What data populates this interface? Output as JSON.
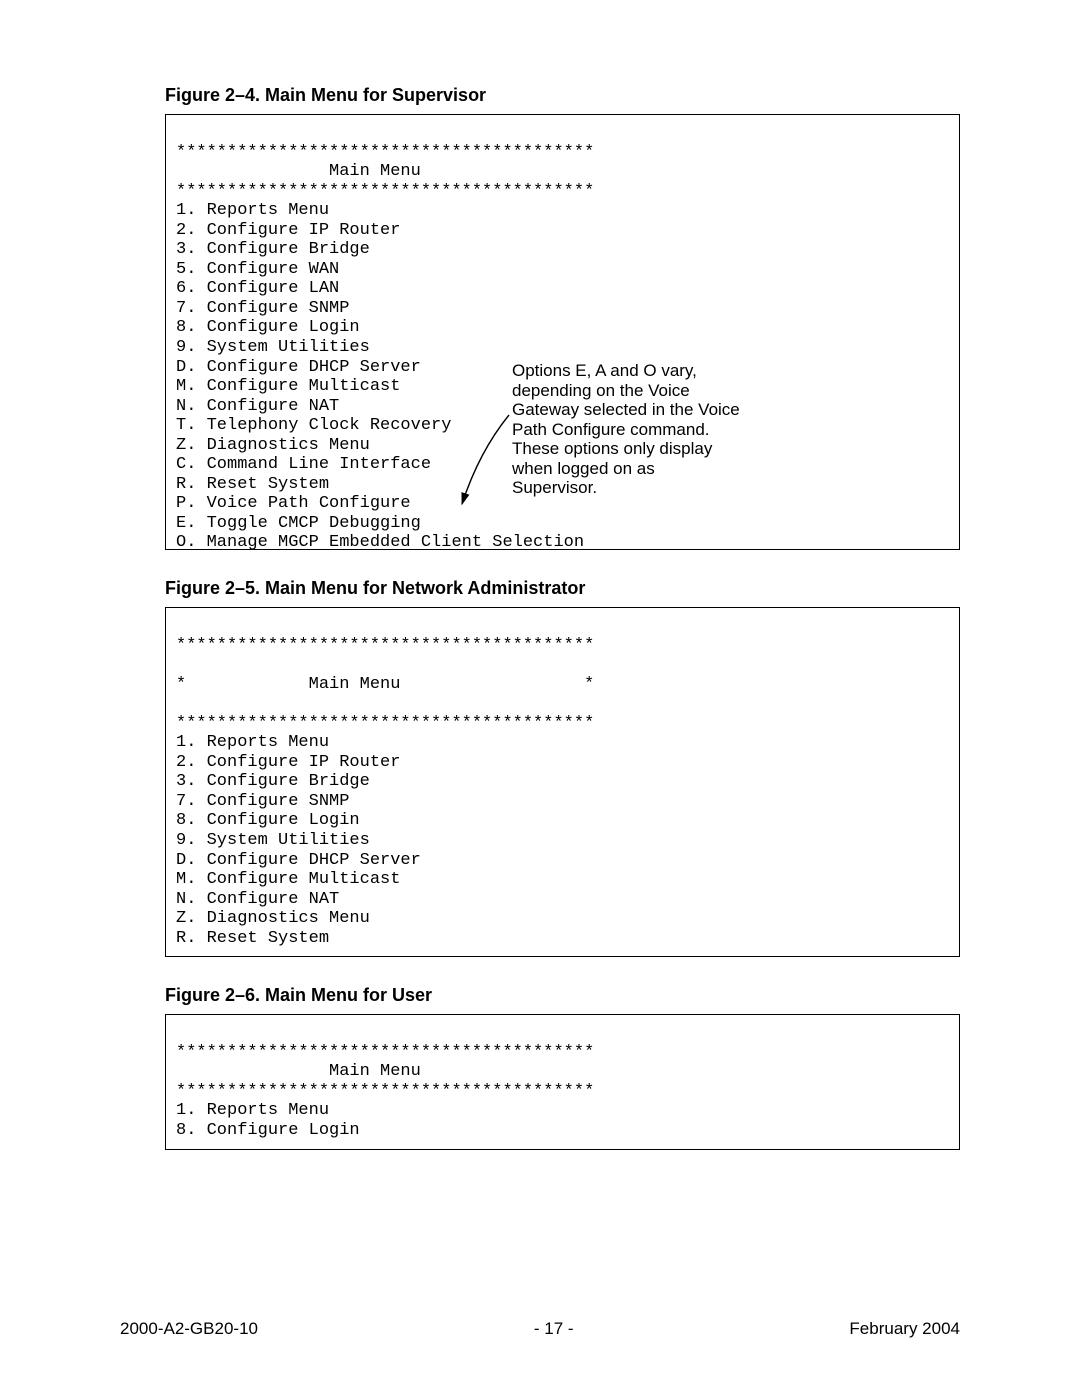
{
  "figures": {
    "fig24": {
      "caption": "Figure 2–4.  Main Menu for Supervisor",
      "star_line": "*****************************************",
      "title_line": "               Main Menu",
      "items": [
        "1. Reports Menu",
        "2. Configure IP Router",
        "3. Configure Bridge",
        "5. Configure WAN",
        "6. Configure LAN",
        "7. Configure SNMP",
        "8. Configure Login",
        "9. System Utilities",
        "D. Configure DHCP Server",
        "M. Configure Multicast",
        "N. Configure NAT",
        "T. Telephony Clock Recovery",
        "Z. Diagnostics Menu",
        "C. Command Line Interface",
        "R. Reset System",
        "P. Voice Path Configure",
        "E. Toggle CMCP Debugging",
        "O. Manage MGCP Embedded Client Selection"
      ],
      "annotation": "Options E, A and O vary, depending on the Voice Gateway selected in the Voice Path Configure command. These options only display when logged on as Supervisor."
    },
    "fig25": {
      "caption": "Figure 2–5.  Main Menu for Network Administrator",
      "star_line": "*****************************************",
      "title_line": "*            Main Menu                  *",
      "items": [
        "1. Reports Menu",
        "2. Configure IP Router",
        "3. Configure Bridge",
        "7. Configure SNMP",
        "8. Configure Login",
        "9. System Utilities",
        "D. Configure DHCP Server",
        "M. Configure Multicast",
        "N. Configure NAT",
        "Z. Diagnostics Menu",
        "R. Reset System"
      ]
    },
    "fig26": {
      "caption": "Figure 2–6.  Main Menu for User",
      "star_line": "*****************************************",
      "title_line": "               Main Menu",
      "items": [
        "1. Reports Menu",
        "8. Configure Login"
      ]
    }
  },
  "footer": {
    "left": "2000-A2-GB20-10",
    "center": "- 17 -",
    "right": "February 2004"
  }
}
